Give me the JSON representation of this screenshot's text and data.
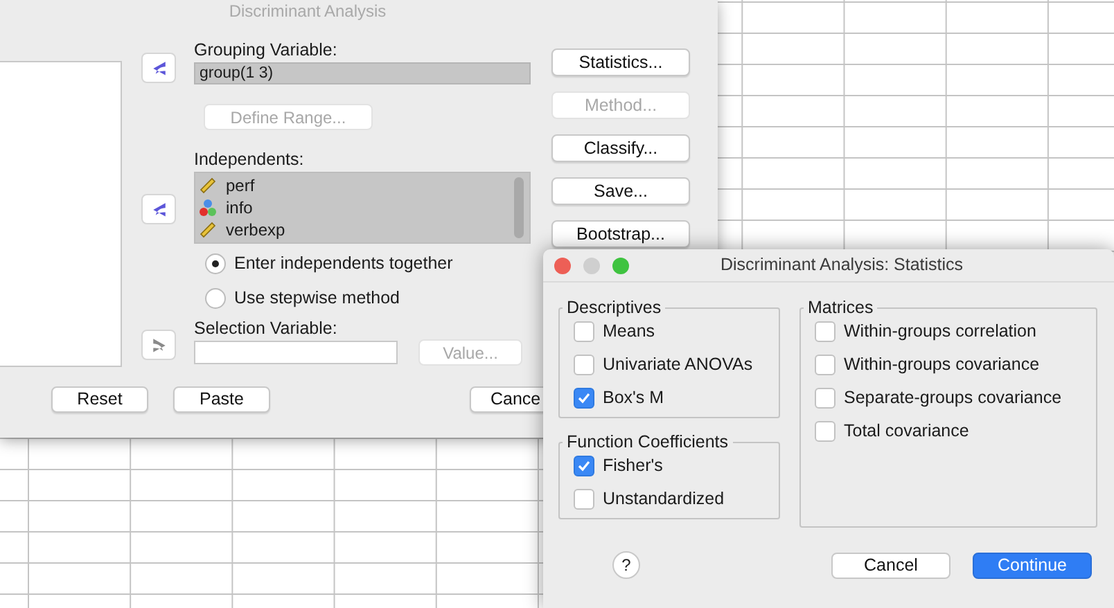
{
  "main_dialog": {
    "title": "Discriminant Analysis",
    "arrow_buttons": [
      {
        "kind": "add",
        "disabled": false
      },
      {
        "kind": "add",
        "disabled": false
      },
      {
        "kind": "remove",
        "disabled": true
      }
    ],
    "grouping_variable": {
      "label": "Grouping Variable:",
      "value": "group(1 3)"
    },
    "define_range_button": {
      "label": "Define Range...",
      "disabled": true
    },
    "independents": {
      "label": "Independents:",
      "items": [
        {
          "name": "perf",
          "kind": "scale",
          "selected": true
        },
        {
          "name": "info",
          "kind": "nominal",
          "selected": true
        },
        {
          "name": "verbexp",
          "kind": "scale",
          "selected": true
        }
      ]
    },
    "method_options": [
      {
        "label": "Enter independents together",
        "selected": true
      },
      {
        "label": "Use stepwise method",
        "selected": false
      }
    ],
    "selection_variable": {
      "label": "Selection Variable:"
    },
    "value_button": {
      "label": "Value...",
      "disabled": true
    },
    "side_buttons": [
      {
        "label": "Statistics...",
        "disabled": false
      },
      {
        "label": "Method...",
        "disabled": true
      },
      {
        "label": "Classify...",
        "disabled": false
      },
      {
        "label": "Save...",
        "disabled": false
      },
      {
        "label": "Bootstrap...",
        "disabled": false
      }
    ],
    "bottom_buttons": [
      "Reset",
      "Paste",
      "Cance"
    ]
  },
  "statistics_dialog": {
    "title": "Discriminant Analysis: Statistics",
    "groups": [
      {
        "title": "Descriptives",
        "options": [
          {
            "label": "Means",
            "checked": false
          },
          {
            "label": "Univariate ANOVAs",
            "checked": false
          },
          {
            "label": "Box's M",
            "checked": true
          }
        ]
      },
      {
        "title": "Function Coefficients",
        "options": [
          {
            "label": "Fisher's",
            "checked": true
          },
          {
            "label": "Unstandardized",
            "checked": false
          }
        ]
      },
      {
        "title": "Matrices",
        "options": [
          {
            "label": "Within-groups correlation",
            "checked": false
          },
          {
            "label": "Within-groups covariance",
            "checked": false
          },
          {
            "label": "Separate-groups covariance",
            "checked": false
          },
          {
            "label": "Total covariance",
            "checked": false
          }
        ]
      }
    ],
    "help_button": "?",
    "buttons": [
      {
        "label": "Cancel",
        "default": false
      },
      {
        "label": "Continue",
        "default": true
      }
    ]
  }
}
